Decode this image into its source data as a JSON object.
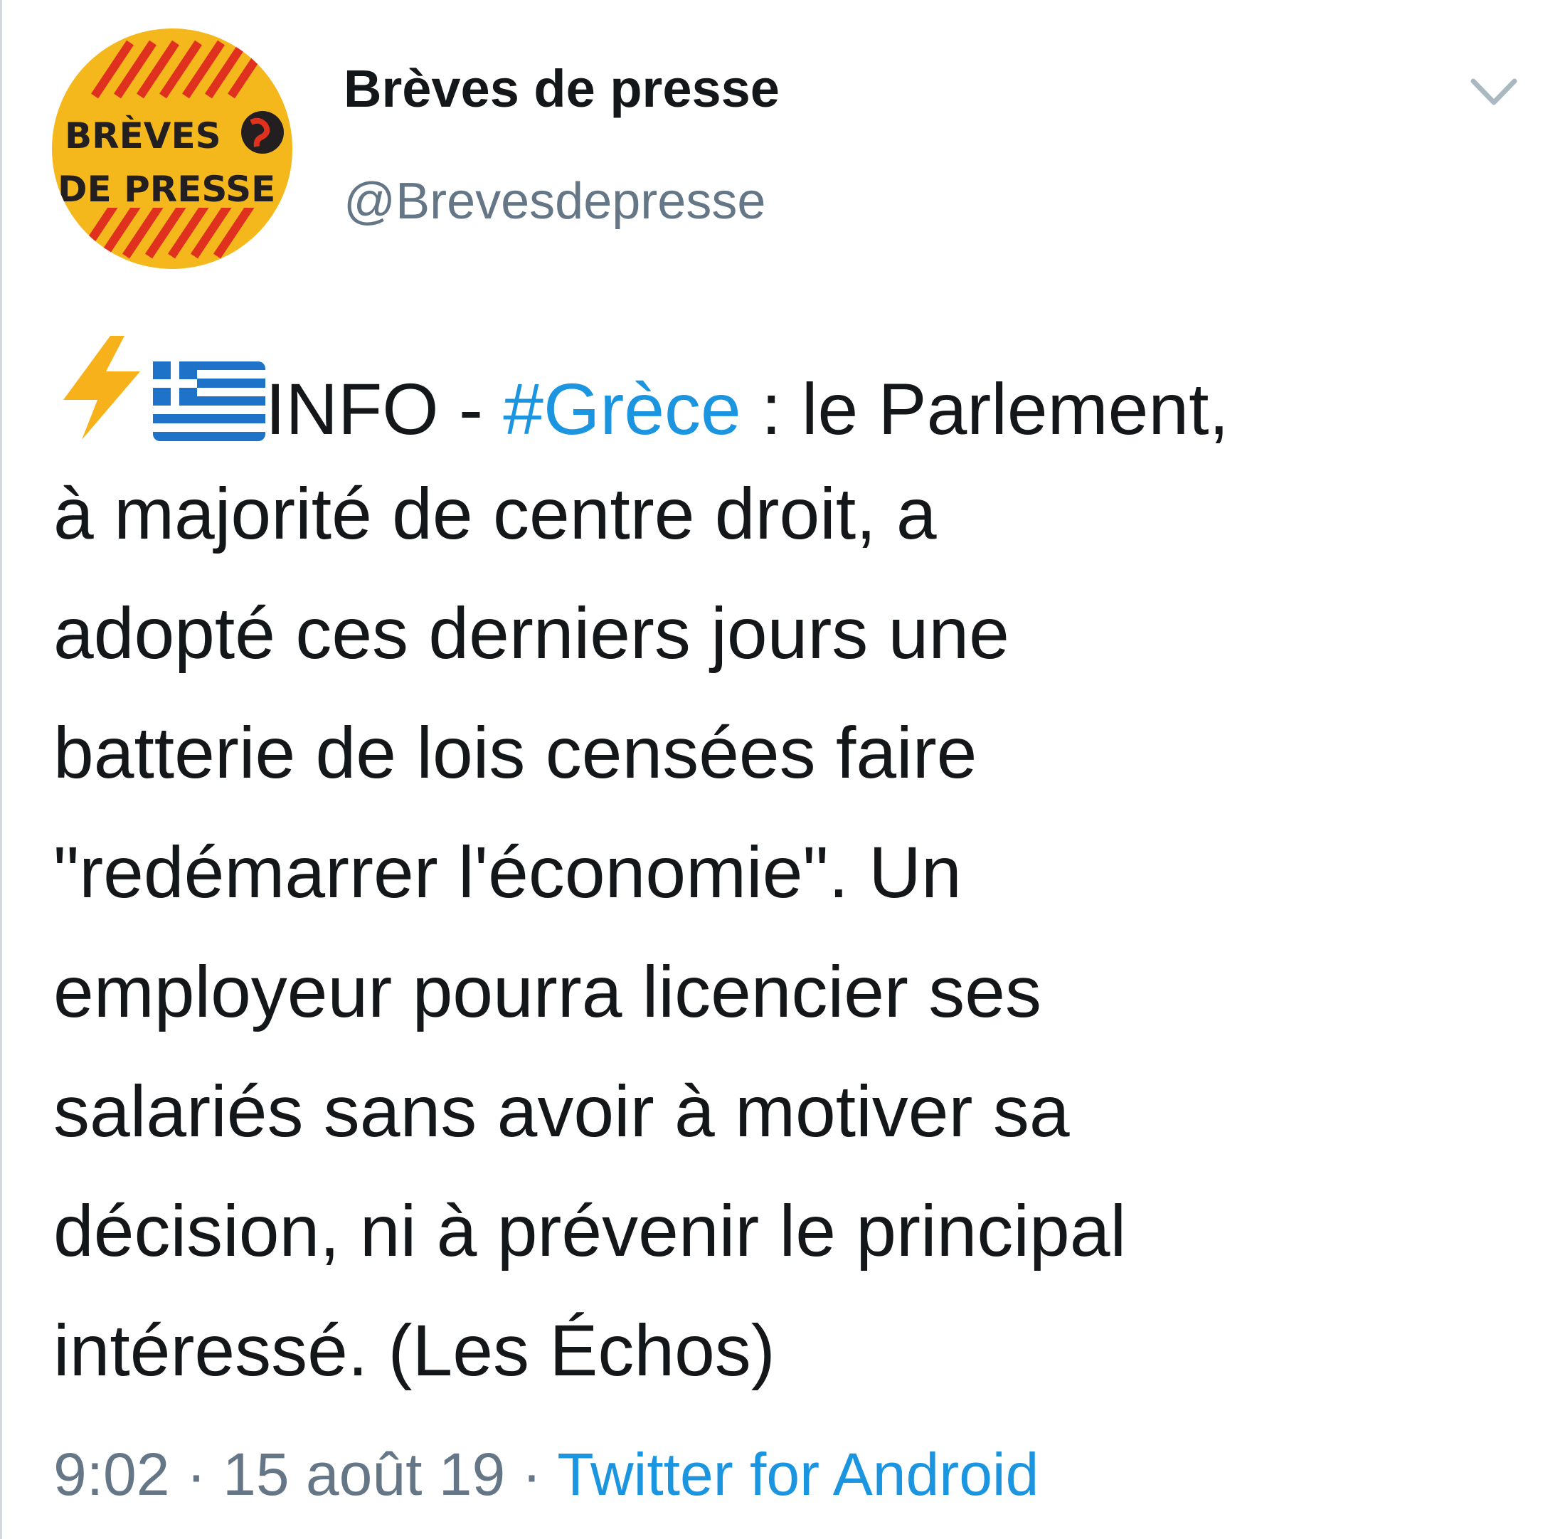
{
  "profile": {
    "display_name": "Brèves de presse",
    "handle": "@Brevesdepresse",
    "avatar_line1": "BRÈVES",
    "avatar_line2": "DE PRESSE"
  },
  "menu_icon": "chevron-down-icon",
  "tweet": {
    "line1_prefix": "INFO - ",
    "hashtag": "#Grèce",
    "line1_suffix": " : le Parlement,",
    "line2": "à majorité de centre droit, a",
    "line3": "adopté ces derniers jours une",
    "line4": "batterie de lois censées faire",
    "line5": "\"redémarrer l'économie\". Un",
    "line6": "employeur pourra licencier ses",
    "line7": "salariés sans avoir à motiver sa",
    "line8": "décision, ni à prévenir le principal",
    "line9": "intéressé. (Les Échos)"
  },
  "meta": {
    "time": "9:02",
    "separator1": " · ",
    "date": "15 août 19",
    "separator2": " · ",
    "source": "Twitter for Android"
  },
  "colors": {
    "link": "#1b95e0",
    "muted": "#657786",
    "text": "#14171a",
    "avatar_yellow": "#f5b81c",
    "avatar_red": "#e0301e"
  }
}
